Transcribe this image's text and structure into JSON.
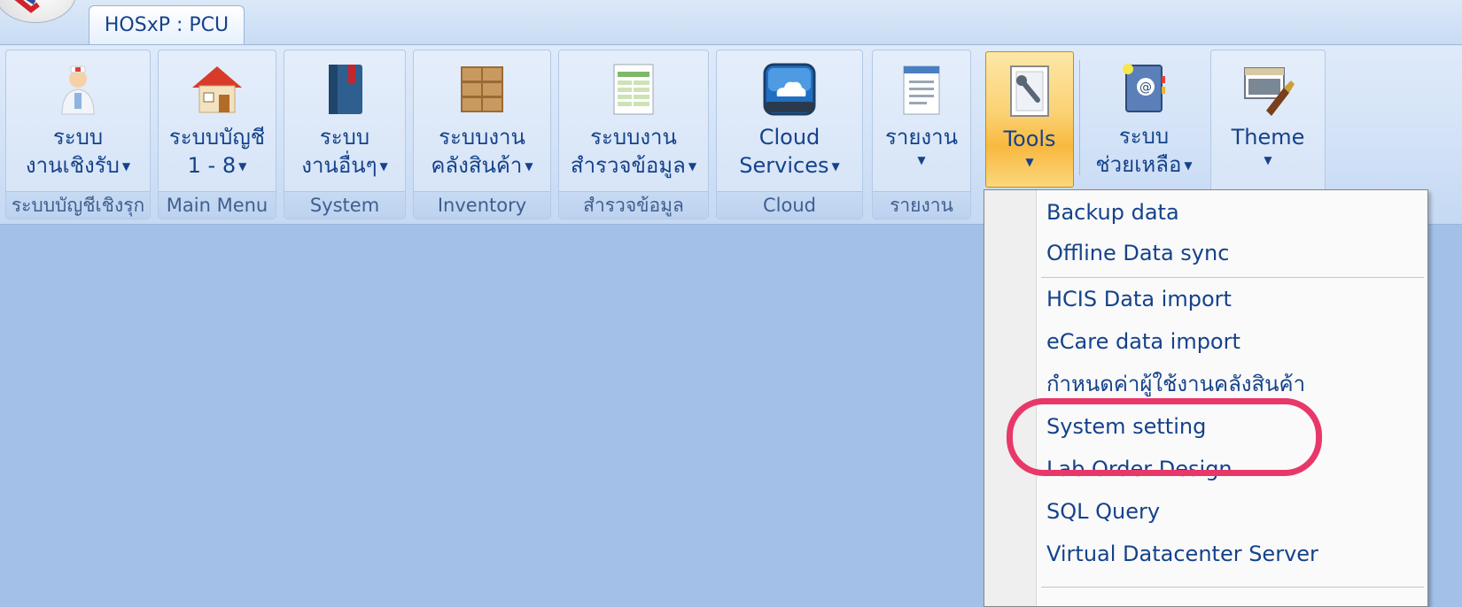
{
  "app": {
    "tab_title": "HOSxP : PCU"
  },
  "ribbon": {
    "groups": [
      {
        "label": "ระบบบัญชีเชิงรุก",
        "button": {
          "line1": "ระบบ",
          "line2": "งานเชิงรับ",
          "icon": "nurse-icon"
        }
      },
      {
        "label": "Main Menu",
        "button": {
          "line1": "ระบบบัญชี",
          "line2": "1 - 8",
          "icon": "house-icon"
        }
      },
      {
        "label": "System",
        "button": {
          "line1": "ระบบ",
          "line2": "งานอื่นๆ",
          "icon": "book-icon"
        }
      },
      {
        "label": "Inventory",
        "button": {
          "line1": "ระบบงาน",
          "line2": "คลังสินค้า",
          "icon": "boxes-icon"
        }
      },
      {
        "label": "สำรวจข้อมูล",
        "button": {
          "line1": "ระบบงาน",
          "line2": "สำรวจข้อมูล",
          "icon": "spreadsheet-icon"
        }
      },
      {
        "label": "Cloud",
        "button": {
          "line1": "Cloud",
          "line2": "Services",
          "icon": "cloud-icon"
        }
      },
      {
        "label": "รายงาน",
        "button": {
          "line1": "รายงาน",
          "line2": "",
          "icon": "report-icon"
        }
      }
    ],
    "tools": {
      "label": "Tools",
      "icon": "wrench-document-icon"
    },
    "help": {
      "line1": "ระบบ",
      "line2": "ช่วยเหลือ",
      "icon": "address-book-icon"
    },
    "theme": {
      "label": "Theme",
      "icon": "paint-brush-icon"
    }
  },
  "tools_menu": {
    "items": [
      "Backup data",
      "Offline Data sync",
      "HCIS Data import",
      "eCare data import",
      "กำหนดค่าผู้ใช้งานคลังสินค้า",
      "System setting",
      "Lab Order Design",
      "SQL Query",
      "Virtual Datacenter Server"
    ]
  },
  "colors": {
    "ribbon_text": "#15428b",
    "workspace": "#a3c0e9",
    "highlight": "#e8386a",
    "tools_active": "#fbd273"
  }
}
